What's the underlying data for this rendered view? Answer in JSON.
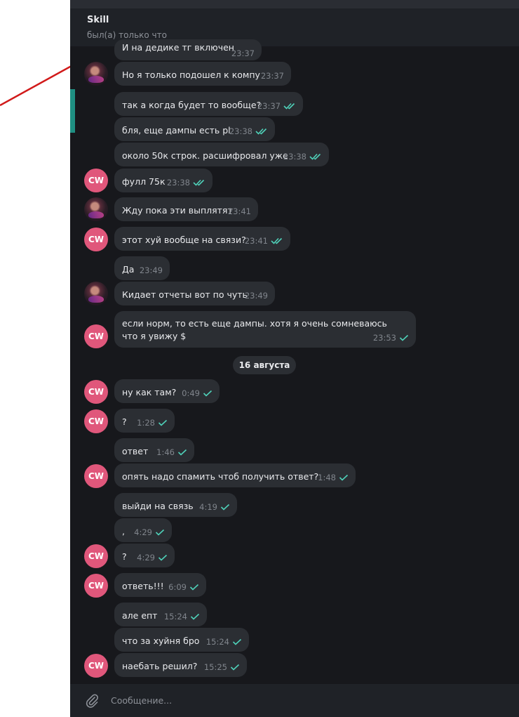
{
  "header": {
    "title": "Skill",
    "status": "был(а) только что"
  },
  "date_separator": "16 августа",
  "composer": {
    "placeholder": "Сообщение..."
  },
  "colors": {
    "background": "#17181c",
    "bubble": "#2b2e33",
    "avatar_cw": "#e0577b",
    "check": "#4fd1b9",
    "accent_bar": "#1f8f82",
    "annotation_arrow": "#d11a1a"
  },
  "messages": [
    {
      "text": "И на дедике тг включен",
      "time": "23:37",
      "avatar": "none",
      "checks": 0
    },
    {
      "text": "Но я только подошел к компу",
      "time": "23:37",
      "avatar": "photo",
      "checks": 0
    },
    {
      "text": "так а когда будет то вообще?",
      "time": "23:37",
      "avatar": "none",
      "checks": 2
    },
    {
      "text": "бля, еще дампы есть pl",
      "time": "23:38",
      "avatar": "none",
      "checks": 2
    },
    {
      "text": "около 50к строк. расшифровал уже",
      "time": "23:38",
      "avatar": "none",
      "checks": 2
    },
    {
      "text": "фулл 75к",
      "time": "23:38",
      "avatar": "CW",
      "checks": 2
    },
    {
      "text": "Жду пока эти выплятят",
      "time": "23:41",
      "avatar": "photo",
      "checks": 0
    },
    {
      "text": "этот хуй вообще на связи?",
      "time": "23:41",
      "avatar": "CW",
      "checks": 2
    },
    {
      "text": "Да",
      "time": "23:49",
      "avatar": "none",
      "checks": 0
    },
    {
      "text": "Кидает отчеты вот по чуть",
      "time": "23:49",
      "avatar": "photo",
      "checks": 0
    },
    {
      "text": "если норм, то есть еще дампы. хотя я очень сомневаюсь что я увижу $",
      "time": "23:53",
      "avatar": "CW",
      "checks": 1
    },
    {
      "text": "ну как там?",
      "time": "0:49",
      "avatar": "CW",
      "checks": 1
    },
    {
      "text": "?",
      "time": "1:28",
      "avatar": "CW",
      "checks": 1
    },
    {
      "text": "ответ",
      "time": "1:46",
      "avatar": "none",
      "checks": 1
    },
    {
      "text": "опять надо спамить чтоб получить ответ?",
      "time": "1:48",
      "avatar": "CW",
      "checks": 1
    },
    {
      "text": "выйди на связь",
      "time": "4:19",
      "avatar": "none",
      "checks": 1
    },
    {
      "text": ",",
      "time": "4:29",
      "avatar": "none",
      "checks": 1
    },
    {
      "text": "?",
      "time": "4:29",
      "avatar": "CW",
      "checks": 1
    },
    {
      "text": "ответь!!!",
      "time": "6:09",
      "avatar": "CW",
      "checks": 1
    },
    {
      "text": "але епт",
      "time": "15:24",
      "avatar": "none",
      "checks": 1
    },
    {
      "text": "что за хуйня бро",
      "time": "15:24",
      "avatar": "none",
      "checks": 1
    },
    {
      "text": "наебать решил?",
      "time": "15:25",
      "avatar": "CW",
      "checks": 1
    }
  ]
}
